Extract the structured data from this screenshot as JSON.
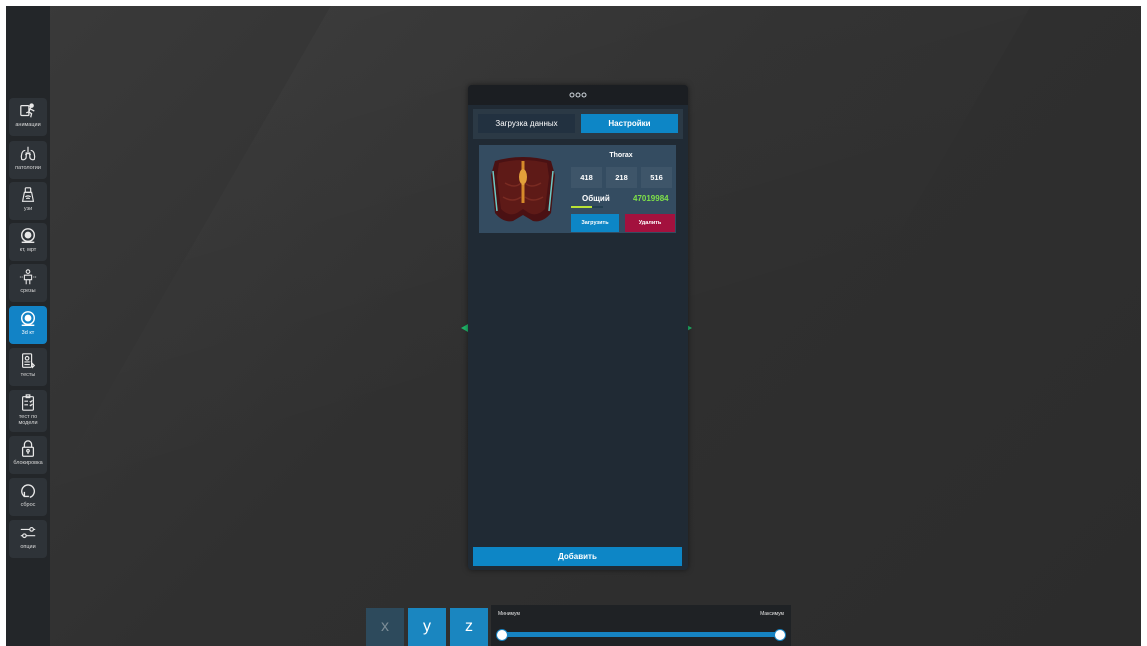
{
  "sidebar": {
    "items": [
      {
        "label": "анимации",
        "icon": "running-figure-icon"
      },
      {
        "label": "патологии",
        "icon": "lungs-icon"
      },
      {
        "label": "узи",
        "icon": "ultrasound-probe-icon"
      },
      {
        "label": "кт, мрт",
        "icon": "ct-scanner-icon"
      },
      {
        "label": "срезы",
        "icon": "body-slices-icon"
      },
      {
        "label": "3d кт",
        "icon": "ct-scanner-icon",
        "active": true
      },
      {
        "label": "тесты",
        "icon": "test-document-icon"
      },
      {
        "label": "тест по\nмодели",
        "icon": "checklist-clipboard-icon"
      },
      {
        "label": "блокировка",
        "icon": "lock-icon"
      },
      {
        "label": "сброс",
        "icon": "reset-icon"
      },
      {
        "label": "опции",
        "icon": "sliders-icon"
      }
    ]
  },
  "panel": {
    "tabs": [
      {
        "label": "Загрузка данных"
      },
      {
        "label": "Настройки",
        "active": true
      }
    ],
    "dataset": {
      "title": "Thorax",
      "dims": [
        "418",
        "218",
        "516"
      ],
      "total_label": "Общий",
      "total_value": "47019984",
      "load_label": "Загрузить",
      "delete_label": "Удалить",
      "progress": 0.65
    },
    "add_label": "Добавить"
  },
  "axes": {
    "x": "x",
    "y": "y",
    "z": "z"
  },
  "range": {
    "min_label": "Минимум",
    "max_label": "Максимум"
  },
  "colors": {
    "accent": "#0d86c6",
    "danger": "#a3113e",
    "success_text": "#7ee04a"
  }
}
